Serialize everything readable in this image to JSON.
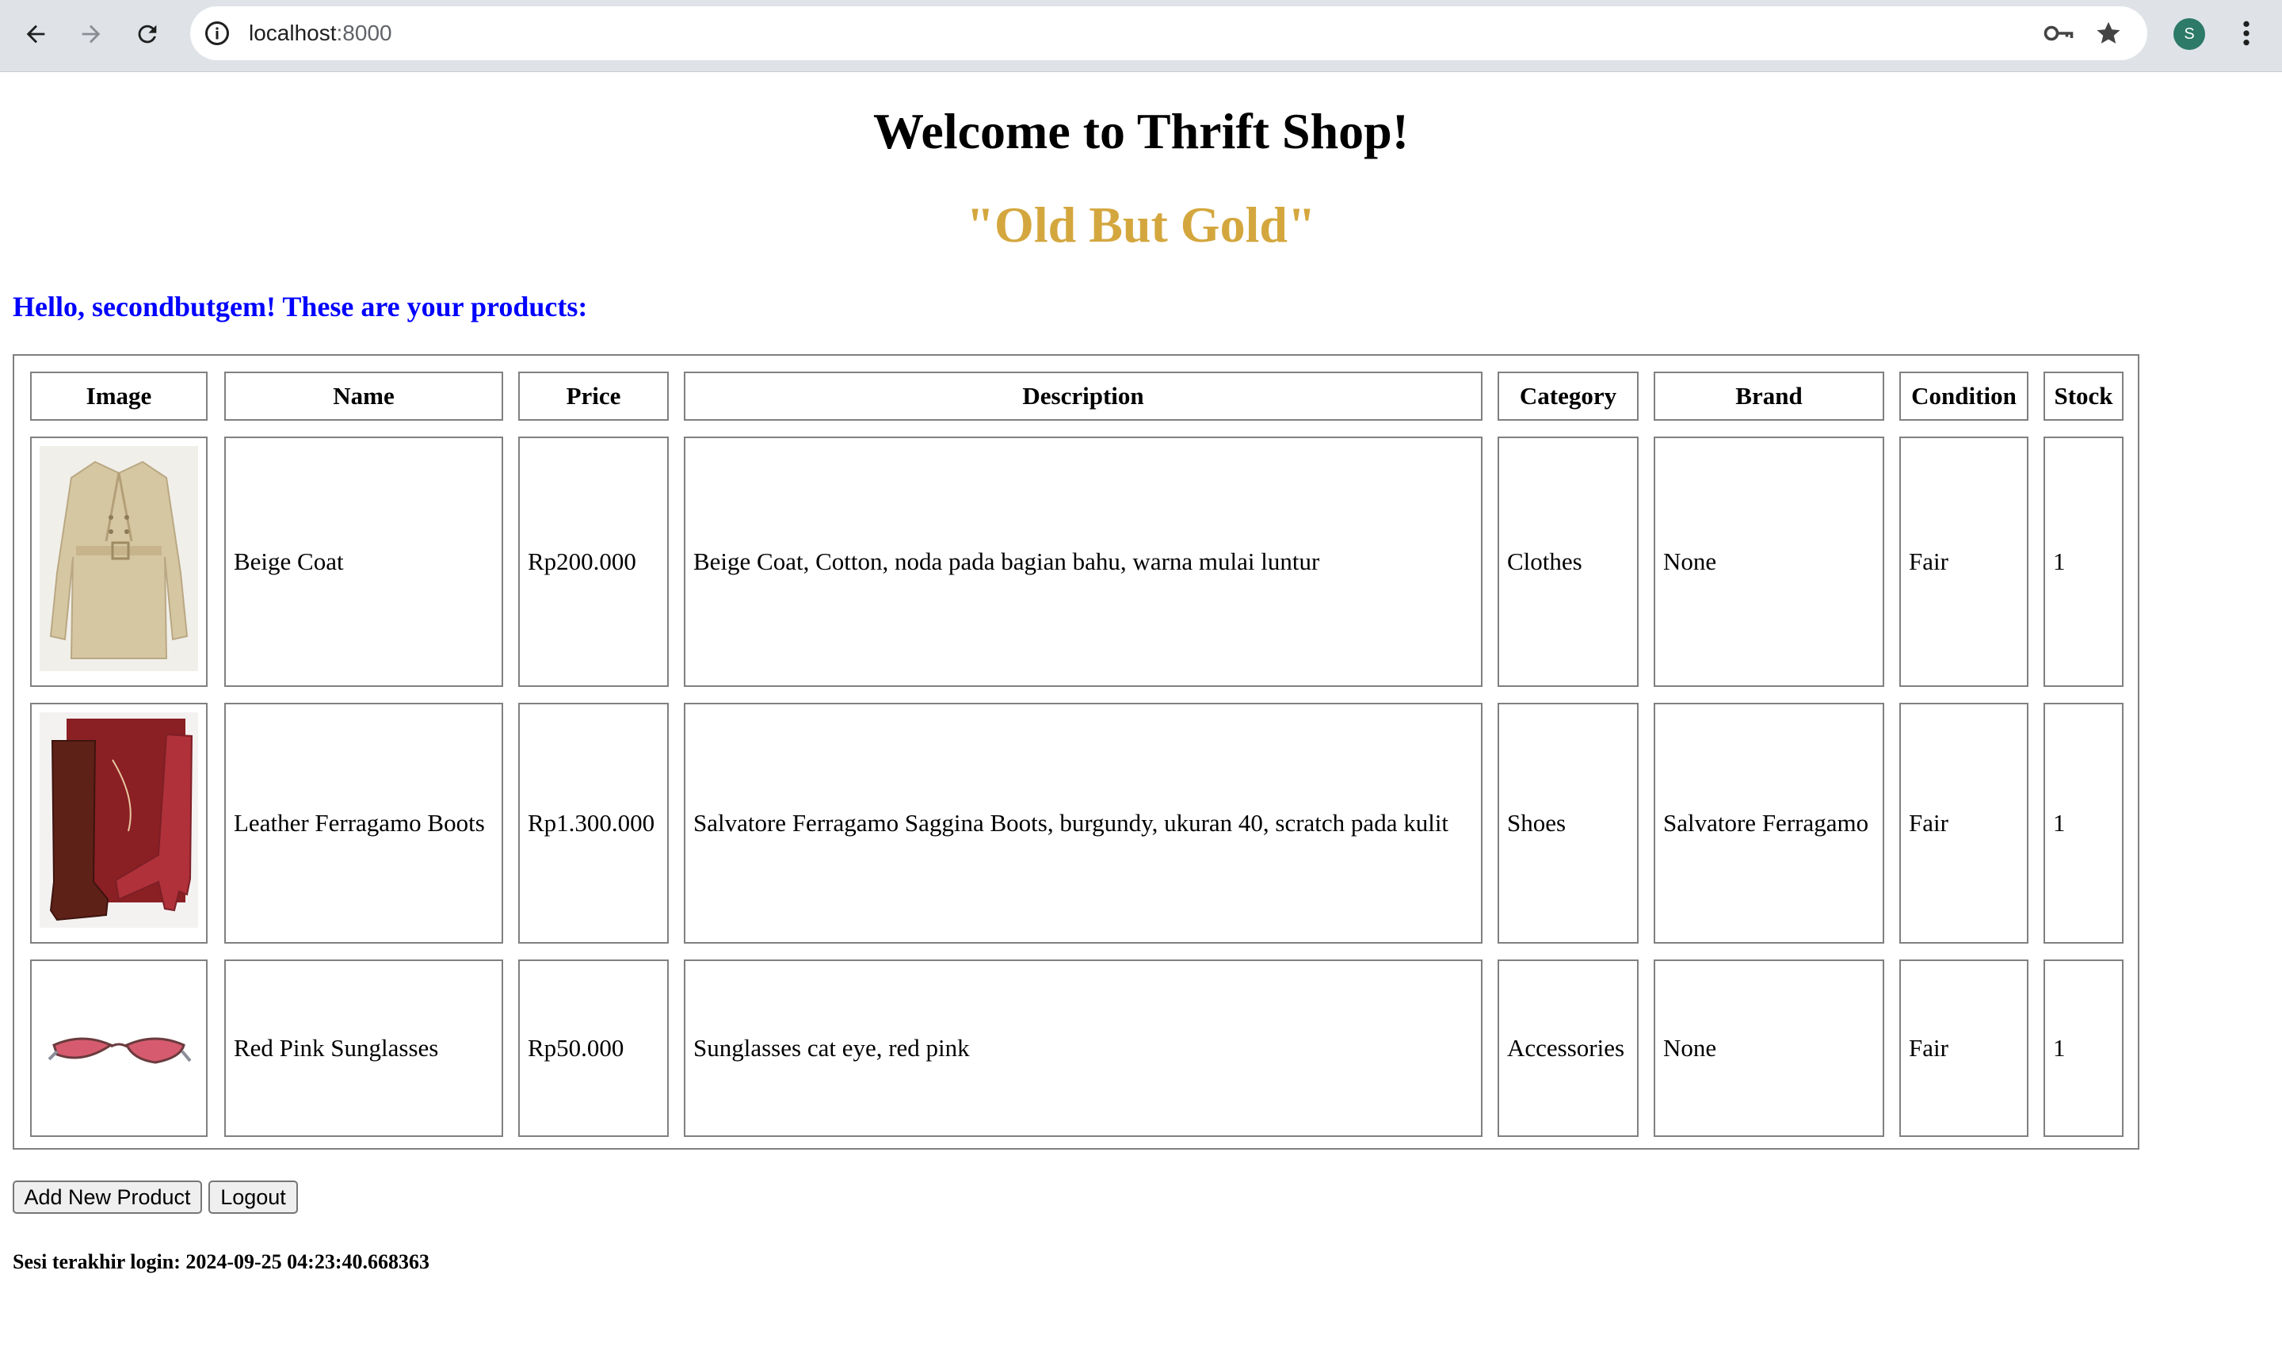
{
  "browser": {
    "url_host": "localhost",
    "url_port": ":8000",
    "profile_initial": "S"
  },
  "page": {
    "title": "Welcome to Thrift Shop!",
    "slogan": "\"Old But Gold\"",
    "greeting": "Hello, secondbutgem! These are your products:"
  },
  "table": {
    "headers": [
      "Image",
      "Name",
      "Price",
      "Description",
      "Category",
      "Brand",
      "Condition",
      "Stock"
    ],
    "rows": [
      {
        "image": "beige-coat-photo",
        "name": "Beige Coat",
        "price": "Rp200.000",
        "description": "Beige Coat, Cotton, noda pada bagian bahu, warna mulai luntur",
        "category": "Clothes",
        "brand": "None",
        "condition": "Fair",
        "stock": "1"
      },
      {
        "image": "ferragamo-boots-photo",
        "name": "Leather Ferragamo Boots",
        "price": "Rp1.300.000",
        "description": "Salvatore Ferragamo Saggina Boots, burgundy, ukuran 40, scratch pada kulit",
        "category": "Shoes",
        "brand": "Salvatore Ferragamo",
        "condition": "Fair",
        "stock": "1"
      },
      {
        "image": "sunglasses-photo",
        "name": "Red Pink Sunglasses",
        "price": "Rp50.000",
        "description": "Sunglasses cat eye, red pink",
        "category": "Accessories",
        "brand": "None",
        "condition": "Fair",
        "stock": "1"
      }
    ]
  },
  "actions": {
    "add_label": "Add New Product",
    "logout_label": "Logout"
  },
  "footer": {
    "last_login": "Sesi terakhir login: 2024-09-25 04:23:40.668363"
  },
  "colors": {
    "slogan": "#d4a73e",
    "greeting": "#0000ff",
    "avatar": "#2c7a67"
  }
}
